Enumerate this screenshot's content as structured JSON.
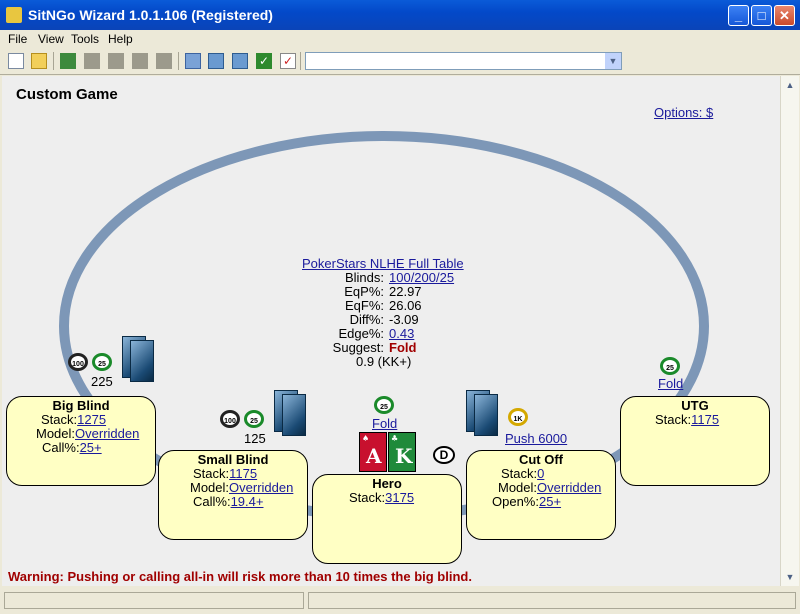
{
  "window": {
    "title": "SitNGo Wizard 1.0.1.106 (Registered)"
  },
  "menu": [
    "File",
    "View",
    "Tools",
    "Help"
  ],
  "toolbar": {
    "icons": [
      "new-document-icon",
      "open-folder-icon",
      "home-icon",
      "disabled-tool-icon",
      "disabled-tool-icon",
      "disabled-tool-icon",
      "disabled-tool-icon",
      "copy-icon",
      "export-icon",
      "image-icon",
      "check-icon",
      "checklist-icon"
    ],
    "combo_value": ""
  },
  "page": {
    "heading": "Custom Game",
    "options_link": "Options: $"
  },
  "table_info": {
    "table_name": "PokerStars NLHE Full Table",
    "blinds_label": "Blinds:",
    "blinds_value": "100/200/25",
    "eqp_label": "EqP%:",
    "eqp_value": "22.97",
    "eqf_label": "EqF%:",
    "eqf_value": "26.06",
    "diff_label": "Diff%:",
    "diff_value": "-3.09",
    "edge_label": "Edge%:",
    "edge_value": "0.43",
    "suggest_label": "Suggest:",
    "suggest_value": "Fold",
    "range_text": "0.9 (KK+)"
  },
  "seats": {
    "big_blind": {
      "name": "Big Blind",
      "stack_label": "Stack:",
      "stack": "1275",
      "model_label": "Model:",
      "model": "Overridden",
      "call_label": "Call%:",
      "call": "25+",
      "bet": "225",
      "chip_labels": [
        "100",
        "25"
      ]
    },
    "small_blind": {
      "name": "Small Blind",
      "stack_label": "Stack:",
      "stack": "1175",
      "model_label": "Model:",
      "model": "Overridden",
      "call_label": "Call%:",
      "call": "19.4+",
      "bet": "125",
      "chip_labels": [
        "100",
        "25"
      ]
    },
    "hero": {
      "name": "Hero",
      "stack_label": "Stack:",
      "stack": "3175",
      "action": "Fold",
      "chip_label": "25",
      "cards": [
        {
          "rank": "A",
          "suit": "♠",
          "color": "#c8102e"
        },
        {
          "rank": "K",
          "suit": "♣",
          "color": "#1f8a3a"
        }
      ],
      "dealer_button": "D"
    },
    "cut_off": {
      "name": "Cut Off",
      "stack_label": "Stack:",
      "stack": "0",
      "model_label": "Model:",
      "model": "Overridden",
      "open_label": "Open%:",
      "open": "25+",
      "action": "Push 6000",
      "chip_label": "1K"
    },
    "utg": {
      "name": "UTG",
      "stack_label": "Stack:",
      "stack": "1175",
      "action": "Fold",
      "chip_label": "25"
    }
  },
  "warning": "Warning: Pushing or calling all-in will risk more than 10 times the big blind.",
  "colors": {
    "seat_fill": "#ffffc4",
    "table_rail": "#7d97b7",
    "link": "#1a1a9c",
    "warning": "#a00000",
    "suggest": "#a00000"
  }
}
